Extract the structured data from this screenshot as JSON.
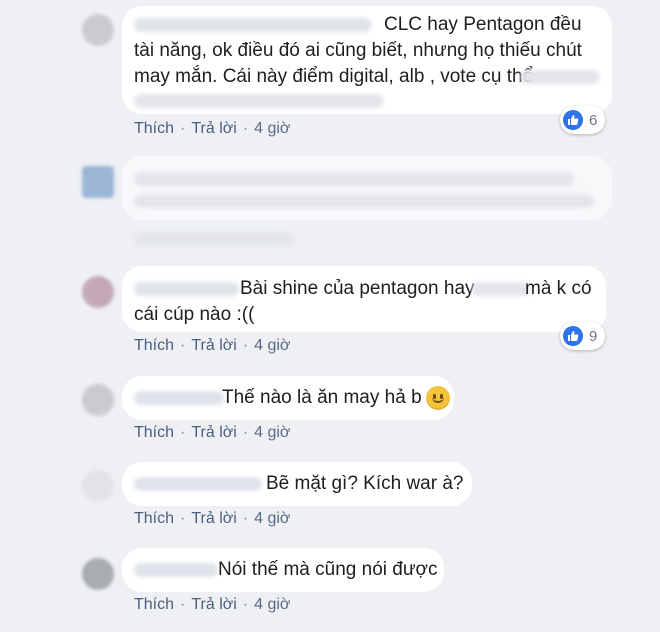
{
  "colors": {
    "background": "#eef0f3",
    "bubble": "#ffffff",
    "action_link": "#4b5f80",
    "like_blue": "#2d74e8"
  },
  "actions": {
    "like": "Thích",
    "reply": "Trả lời",
    "separator": "·",
    "time": "4 giờ"
  },
  "comments": [
    {
      "lines": [
        "CLC hay Pentagon đều",
        "tài năng, ok điều đó ai cũng biết, nhưng họ thiếu chút",
        "may mắn. Cái này điểm digital, alb , vote cụ thể"
      ],
      "reactions": "6",
      "reaction_icon": "like-icon"
    },
    {
      "lines": []
    },
    {
      "lines": [
        "Bài shine của pentagon hay",
        "mà k có",
        "cái cúp nào :(("
      ],
      "reactions": "9",
      "reaction_icon": "like-icon"
    },
    {
      "lines": [
        "Thế nào là ăn may hả b"
      ],
      "emoji": "slightly-smiling-face-icon"
    },
    {
      "lines": [
        "Bẽ mặt gì? Kích war à?"
      ]
    },
    {
      "lines": [
        "Nói thế mà cũng nói được"
      ]
    }
  ]
}
